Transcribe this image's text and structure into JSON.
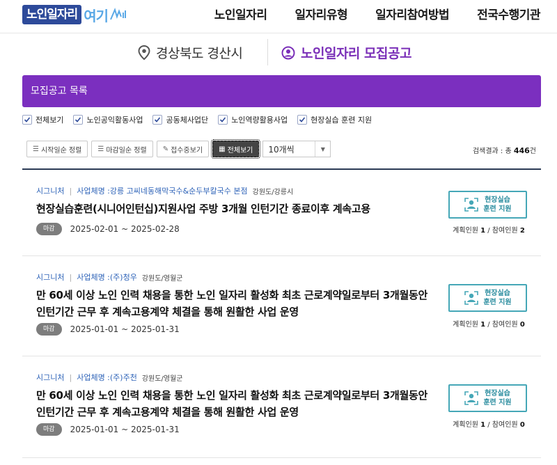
{
  "header": {
    "logo": {
      "main": "노인일자리",
      "accent": "여기"
    },
    "nav": [
      "노인일자리",
      "일자리유형",
      "일자리참여방법",
      "전국수행기관"
    ]
  },
  "location": {
    "region": "경상북도 경산시",
    "page_title": "노인일자리 모집공고"
  },
  "list_header": "모집공고 목록",
  "filters": [
    "전체보기",
    "노인공익활동사업",
    "공동체사업단",
    "노인역량활용사업",
    "현장실습 훈련 지원"
  ],
  "toolbar": {
    "sort_start": "시작일순 정렬",
    "sort_end": "마감일순 정렬",
    "accepting": "접수중보기",
    "view_all": "전체보기",
    "page_size": "10개씩"
  },
  "result": {
    "label": "검색결과 : 총 ",
    "count": "446",
    "unit": "건"
  },
  "listings": [
    {
      "category": "시그니처",
      "company_label": "사업체명 : ",
      "company": "강릉 고씨네동해막국수&순두부칼국수 본점",
      "region": "강원도/강릉시",
      "title": "현장실습훈련(시니어인턴십)지원사업 주방 3개월 인턴기간 종료이후 계속고용",
      "status": "마감",
      "dates": "2025-02-01 ~ 2025-02-28",
      "type_line1": "현장실습",
      "type_line2": "훈련 지원",
      "plan_label": "계획인원 ",
      "plan": "1",
      "count_sep": " / 참여인원 ",
      "participants": "2"
    },
    {
      "category": "시그니처",
      "company_label": "사업체명 : ",
      "company": "(주)청우",
      "region": "강원도/영월군",
      "title": "만 60세 이상 노인 인력 채용을 통한 노인 일자리 활성화 최초 근로계약일로부터 3개월동안 인턴기간 근무 후 계속고용계약 체결을 통해 원활한 사업 운영",
      "status": "마감",
      "dates": "2025-01-01 ~ 2025-01-31",
      "type_line1": "현장실습",
      "type_line2": "훈련 지원",
      "plan_label": "계획인원 ",
      "plan": "1",
      "count_sep": " / 참여인원 ",
      "participants": "0"
    },
    {
      "category": "시그니처",
      "company_label": "사업체명 : ",
      "company": "(주)주천",
      "region": "강원도/영월군",
      "title": "만 60세 이상 노인 인력 채용을 통한 노인 일자리 활성화 최초 근로계약일로부터 3개월동안 인턴기간 근무 후 계속고용계약 체결을 통해 원활한 사업 운영",
      "status": "마감",
      "dates": "2025-01-01 ~ 2025-01-31",
      "type_line1": "현장실습",
      "type_line2": "훈련 지원",
      "plan_label": "계획인원 ",
      "plan": "1",
      "count_sep": " / 참여인원 ",
      "participants": "0"
    }
  ],
  "colors": {
    "brand": "#2d4a9a",
    "accent_purple": "#7b2fbf",
    "teal": "#45a7b7",
    "link_blue": "#2e63b8"
  }
}
